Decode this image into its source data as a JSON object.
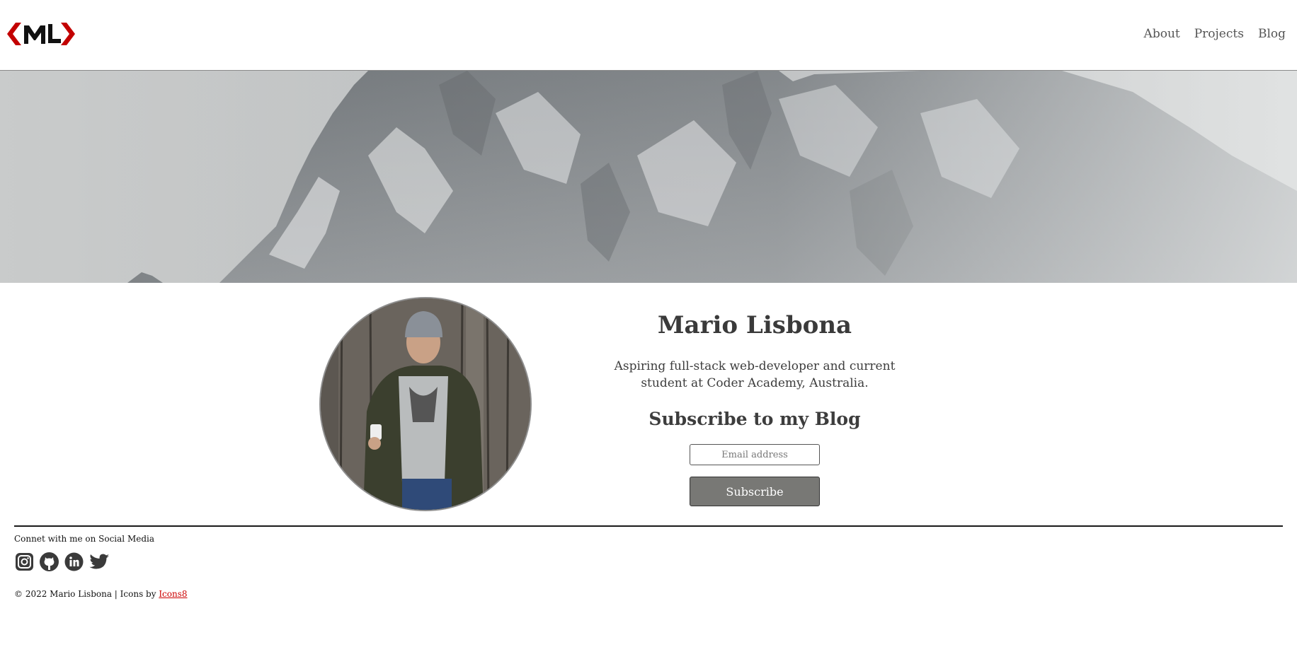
{
  "header": {
    "logo_text": "ML",
    "nav": [
      {
        "label": "About"
      },
      {
        "label": "Projects"
      },
      {
        "label": "Blog"
      }
    ]
  },
  "profile": {
    "name": "Mario Lisbona",
    "bio": "Aspiring full-stack web-developer and current student at Coder Academy, Australia.",
    "subscribe_title": "Subscribe to my Blog",
    "email_placeholder": "Email address",
    "subscribe_label": "Subscribe"
  },
  "footer": {
    "social_heading": "Connet with me on Social Media",
    "social_icons": [
      "instagram-icon",
      "github-icon",
      "linkedin-icon",
      "twitter-icon"
    ],
    "copyright_prefix": "© 2022 Mario Lisbona | Icons by ",
    "icons_link": "Icons8"
  },
  "colors": {
    "accent": "#cc0000",
    "button": "#787875",
    "text": "#3d3d3d"
  }
}
